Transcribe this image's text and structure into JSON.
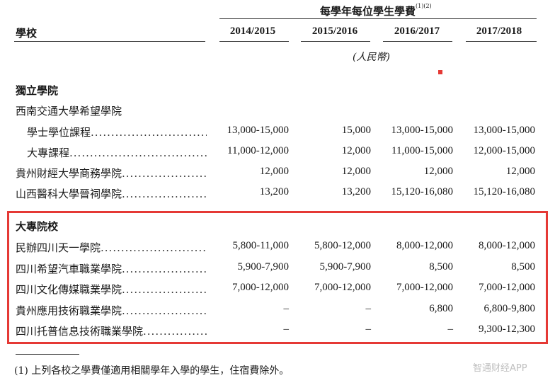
{
  "header": {
    "fee_title": "每學年每位學生學費",
    "fee_title_sup": "(1)(2)",
    "school_col": "學校",
    "years": [
      "2014/2015",
      "2015/2016",
      "2016/2017",
      "2017/2018"
    ],
    "unit": "(人民幣)"
  },
  "sections": [
    {
      "title": "獨立學院",
      "rows": [
        {
          "label": "西南交通大學希望學院",
          "indent": false,
          "dots": "",
          "values": [
            "",
            "",
            "",
            ""
          ]
        },
        {
          "label": "學士學位課程",
          "indent": true,
          "dots": "...............................",
          "values": [
            "13,000-15,000",
            "15,000",
            "13,000-15,000",
            "13,000-15,000"
          ]
        },
        {
          "label": "大專課程",
          "indent": true,
          "dots": "...................................",
          "values": [
            "11,000-12,000",
            "12,000",
            "11,000-15,000",
            "12,000-15,000"
          ]
        },
        {
          "label": "貴州財經大學商務學院",
          "indent": false,
          "dots": "..........................",
          "values": [
            "12,000",
            "12,000",
            "12,000",
            "12,000"
          ]
        },
        {
          "label": "山西醫科大學晉祠學院",
          "indent": false,
          "dots": "..........................",
          "values": [
            "13,200",
            "13,200",
            "15,120-16,080",
            "15,120-16,080"
          ]
        }
      ]
    },
    {
      "title": "大專院校",
      "rows": [
        {
          "label": "民辦四川天一學院",
          "indent": false,
          "dots": "....................................",
          "values": [
            "5,800-11,000",
            "5,800-12,000",
            "8,000-12,000",
            "8,000-12,000"
          ]
        },
        {
          "label": "四川希望汽車職業學院",
          "indent": false,
          "dots": "..........................",
          "values": [
            "5,900-7,900",
            "5,900-7,900",
            "8,500",
            "8,500"
          ]
        },
        {
          "label": "四川文化傳媒職業學院",
          "indent": false,
          "dots": "..........................",
          "values": [
            "7,000-12,000",
            "7,000-12,000",
            "7,000-12,000",
            "7,000-12,000"
          ]
        },
        {
          "label": "貴州應用技術職業學院",
          "indent": false,
          "dots": "..........................",
          "values": [
            "–",
            "–",
            "6,800",
            "6,800-9,800"
          ]
        },
        {
          "label": "四川托普信息技術職業學院",
          "indent": false,
          "dots": "...................",
          "values": [
            "–",
            "–",
            "–",
            "9,300-12,300"
          ]
        }
      ]
    }
  ],
  "footnote": "(1)  上列各校之學費僅適用相關學年入學的學生，住宿費除外。",
  "watermark": "智通财经APP",
  "colors": {
    "highlight": "#e53935",
    "text": "#1a1a1a"
  }
}
